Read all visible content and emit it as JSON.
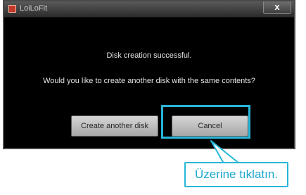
{
  "window": {
    "title": "LoiLoFit",
    "close_symbol": "x"
  },
  "dialog": {
    "message_line1": "Disk creation successful.",
    "message_line2": "Would you like to create another disk with the same contents?",
    "buttons": {
      "create_another": "Create another disk",
      "cancel": "Cancel"
    }
  },
  "annotation": {
    "callout_text": "Üzerine tıklatın.",
    "accent_color": "#27b6d8"
  },
  "icons": {
    "app_icon": "loilofit-app-icon",
    "close_icon": "close-icon"
  }
}
